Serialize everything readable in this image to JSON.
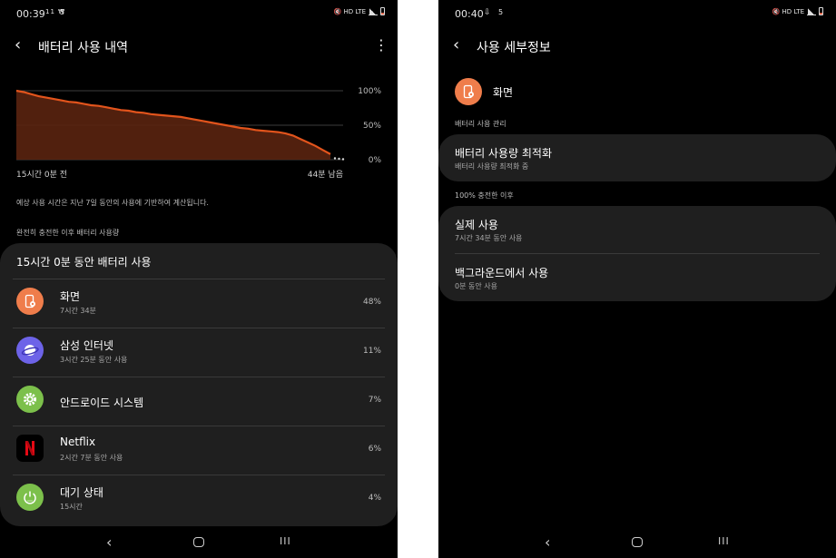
{
  "left_screen": {
    "status": {
      "time": "00:39",
      "extra": "11 ₩",
      "extra2": "5",
      "icons": "🔇 HD LTE"
    },
    "header": {
      "title": "배터리 사용 내역"
    },
    "chart_data": {
      "type": "area",
      "title": "",
      "xlabel": "",
      "ylabel": "",
      "x_start_label": "15시간 0분 전",
      "x_end_label": "44분 남음",
      "y_ticks": [
        "100%",
        "50%",
        "0%"
      ],
      "ylim": [
        0,
        100
      ],
      "grid": true,
      "series": [
        {
          "name": "",
          "values": [
            100,
            98,
            95,
            92,
            90,
            88,
            86,
            84,
            83,
            81,
            79,
            78,
            76,
            74,
            72,
            71,
            69,
            68,
            66,
            65,
            64,
            63,
            62,
            60,
            58,
            56,
            54,
            52,
            50,
            48,
            46,
            45,
            43,
            42,
            41,
            40,
            38,
            35,
            30,
            25,
            20,
            14,
            8
          ]
        }
      ],
      "projection_dots": 3,
      "line_color": "#e2541c",
      "fill_color": "#5a2410"
    },
    "footnote": "예상 사용 시간은 지난 7일 동안의 사용에 기반하여 계산됩니다.",
    "section_label": "완전히 충전한 이후 배터리 사용량",
    "usage_card": {
      "title": "15시간 0분 동안 배터리 사용",
      "apps": [
        {
          "name": "화면",
          "sub": "7시간 34분",
          "pct": "48%",
          "icon": "screen-icon",
          "color": "#ef7d4b"
        },
        {
          "name": "삼성 인터넷",
          "sub": "3시간 25분 동안 사용",
          "pct": "11%",
          "icon": "samsung-internet-icon",
          "color": "#6d63e8"
        },
        {
          "name": "안드로이드 시스템",
          "sub": "",
          "pct": "7%",
          "icon": "android-system-gear-icon",
          "color": "#7cc04b"
        },
        {
          "name": "Netflix",
          "sub": "2시간 7분 동안 사용",
          "pct": "6%",
          "icon": "netflix-icon",
          "color": "#000000"
        },
        {
          "name": "대기 상태",
          "sub": "15시간",
          "pct": "4%",
          "icon": "standby-power-icon",
          "color": "#7cc04b"
        }
      ]
    }
  },
  "right_screen": {
    "status": {
      "time": "00:40",
      "extra2": "5",
      "icons": "🔇 HD LTE"
    },
    "header": {
      "title": "사용 세부정보"
    },
    "item": {
      "name": "화면",
      "icon": "screen-icon",
      "color": "#ef7d4b"
    },
    "group1_label": "배터리 사용 관리",
    "optimize": {
      "title": "배터리 사용량 최적화",
      "sub": "배터리 사용량 최적화 중"
    },
    "group2_label": "100% 충전한 이후",
    "actual": {
      "title": "실제 사용",
      "sub": "7시간 34분 동안 사용"
    },
    "background": {
      "title": "백그라운드에서 사용",
      "sub": "0분 동안 사용"
    }
  },
  "nav": {
    "recent_glyph": "III"
  }
}
